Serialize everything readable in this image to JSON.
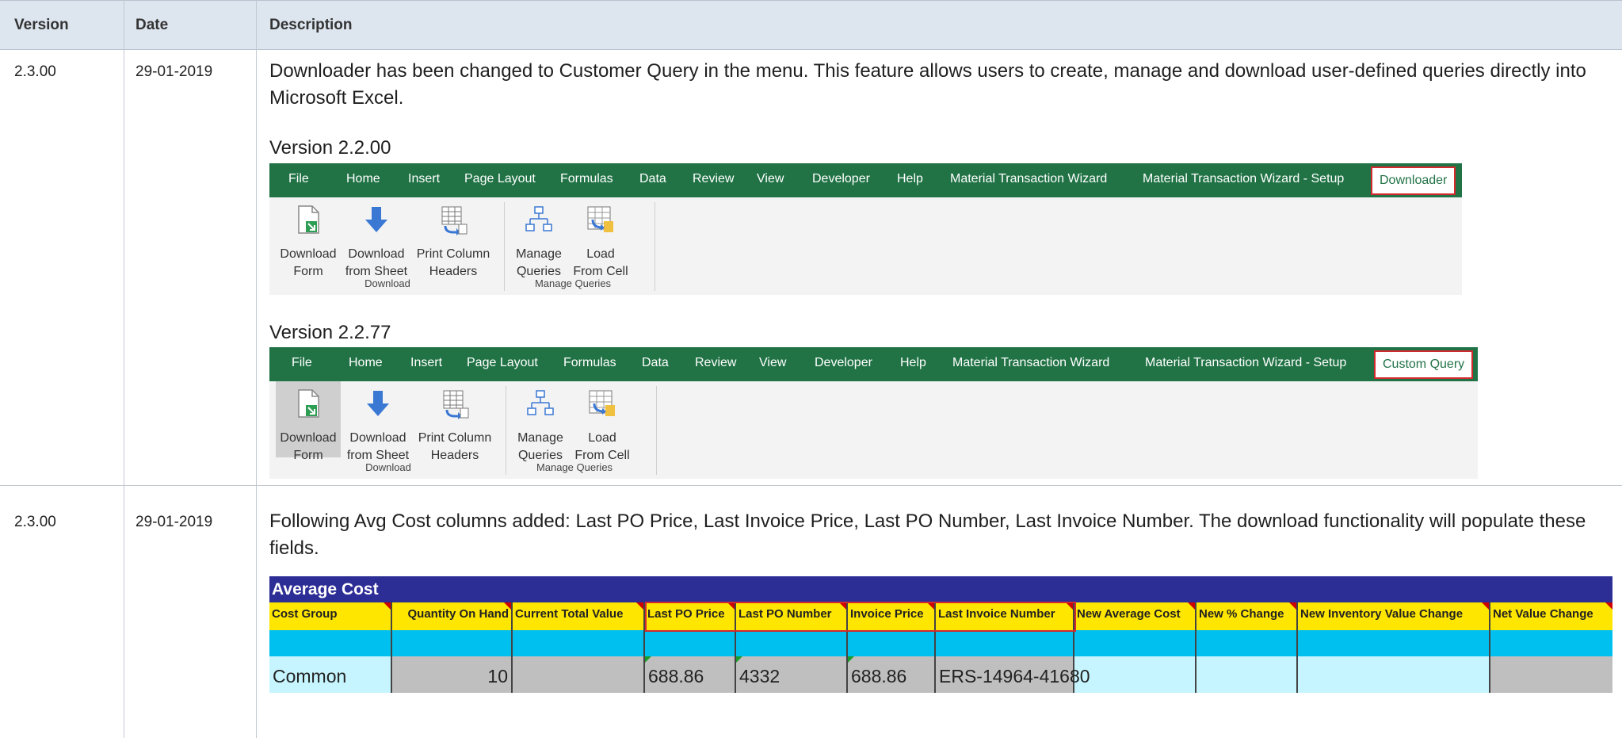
{
  "table": {
    "headers": [
      "Version",
      "Date",
      "Description"
    ],
    "rows": [
      {
        "version": "2.3.00",
        "date": "29-01-2019",
        "description": "Downloader has been changed to Customer Query in the menu.  This feature allows users to create, manage and download user-defined queries directly into Microsoft Excel.",
        "ribbons": [
          {
            "label": "Version 2.2.00",
            "tabs": [
              "File",
              "Home",
              "Insert",
              "Page Layout",
              "Formulas",
              "Data",
              "Review",
              "View",
              "Developer",
              "Help",
              "Material Transaction Wizard",
              "Material Transaction Wizard - Setup"
            ],
            "active_tab": "Downloader",
            "buttons": [
              {
                "line1": "Download",
                "line2": "Form",
                "icon": "download-form-icon"
              },
              {
                "line1": "Download",
                "line2": "from Sheet",
                "icon": "download-arrow-icon"
              },
              {
                "line1": "Print Column",
                "line2": "Headers",
                "icon": "print-column-headers-icon"
              },
              {
                "line1": "Manage",
                "line2": "Queries",
                "icon": "manage-queries-icon"
              },
              {
                "line1": "Load",
                "line2": "From Cell",
                "icon": "load-from-cell-icon"
              }
            ],
            "groups": [
              "Download",
              "Manage Queries"
            ]
          },
          {
            "label": "Version 2.2.77",
            "tabs": [
              "File",
              "Home",
              "Insert",
              "Page Layout",
              "Formulas",
              "Data",
              "Review",
              "View",
              "Developer",
              "Help",
              "Material Transaction Wizard",
              "Material Transaction Wizard - Setup"
            ],
            "active_tab": "Custom Query",
            "buttons": [
              {
                "line1": "Download",
                "line2": "Form",
                "icon": "download-form-icon"
              },
              {
                "line1": "Download",
                "line2": "from Sheet",
                "icon": "download-arrow-icon"
              },
              {
                "line1": "Print Column",
                "line2": "Headers",
                "icon": "print-column-headers-icon"
              },
              {
                "line1": "Manage",
                "line2": "Queries",
                "icon": "manage-queries-icon"
              },
              {
                "line1": "Load",
                "line2": "From Cell",
                "icon": "load-from-cell-icon"
              }
            ],
            "groups": [
              "Download",
              "Manage Queries"
            ]
          }
        ]
      },
      {
        "version": "2.3.00",
        "date": "29-01-2019",
        "description": "Following Avg Cost columns added:  Last PO Price, Last Invoice Price, Last PO Number, Last Invoice Number.  The download functionality will populate these fields.",
        "sheet": {
          "title": "Average Cost",
          "columns": [
            "Cost Group",
            "Quantity On Hand",
            "Current Total Value",
            "Last PO Price",
            "Last PO Number",
            "Invoice Price",
            "Last Invoice Number",
            "New Average Cost",
            "New % Change",
            "New Inventory Value Change",
            "Net Value Change"
          ],
          "data_row": [
            "Common",
            "10",
            "",
            "688.86",
            "4332",
            "688.86",
            "ERS-14964-41680",
            "",
            "",
            "",
            ""
          ]
        }
      }
    ]
  },
  "colors": {
    "ribbon_green": "#217346",
    "highlight_red": "#d2292e",
    "header_yellow": "#ffe600",
    "title_blue": "#2d2d96",
    "cyan": "#00c0f0"
  }
}
